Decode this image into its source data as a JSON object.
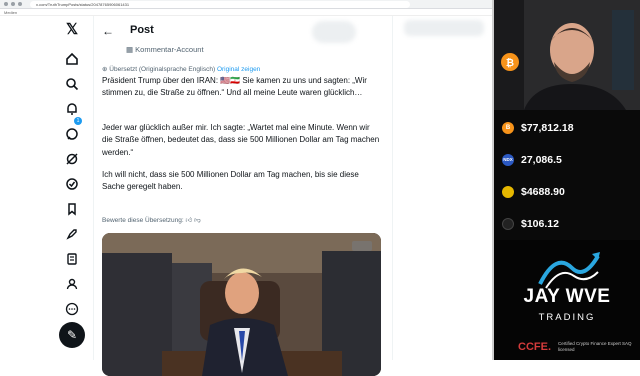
{
  "browser": {
    "url": "x.com/TruthTrumpPosts/status/20478765906061431",
    "tab_label": "Medien"
  },
  "post": {
    "header_title": "Post",
    "comment_account": "Kommentar-Account",
    "translated_label": "Übersetzt (Originalsprache Englisch)",
    "show_original": "Original zeigen",
    "paragraph_1": "Präsident Trump über den IRAN: 🇺🇸🇮🇷 Sie kamen zu uns und sagten: „Wir stimmen zu, die Straße zu öffnen.“ Und all meine Leute waren glücklich…",
    "paragraph_2": "Jeder war glücklich außer mir. Ich sagte: „Wartet mal eine Minute. Wenn wir die Straße öffnen, bedeutet das, dass sie 500 Millionen Dollar am Tag machen werden.“",
    "paragraph_3": "Ich will nicht, dass sie 500 Millionen Dollar am Tag machen, bis sie diese Sache geregelt haben.",
    "rate_label": "Bewerte diese Übersetzung:"
  },
  "sidebar": {
    "notification_count": "1",
    "icons": [
      "x-logo-icon",
      "home-icon",
      "search-icon",
      "notifications-icon",
      "messages-icon",
      "grok-icon",
      "communities-icon",
      "bookmarks-icon",
      "premium-icon",
      "jobs-icon",
      "profile-icon",
      "more-icon",
      "compose-icon"
    ]
  },
  "ticker": {
    "rows": [
      {
        "coin": "B",
        "value": "$77,812.18",
        "color": "#f7931a"
      },
      {
        "coin": "NDX",
        "value": "27,086.5",
        "color": "#2b59c3"
      },
      {
        "coin": "",
        "value": "$4688.90",
        "color": "#e6b800"
      },
      {
        "coin": "",
        "value": "$106.12",
        "color": "#222222"
      }
    ]
  },
  "brand": {
    "name": "JAY WVE",
    "sub": "TRADING",
    "cert_logo": "CCFE.",
    "cert_text": "Certified Crypto Finance Expert SAQ licensed"
  }
}
